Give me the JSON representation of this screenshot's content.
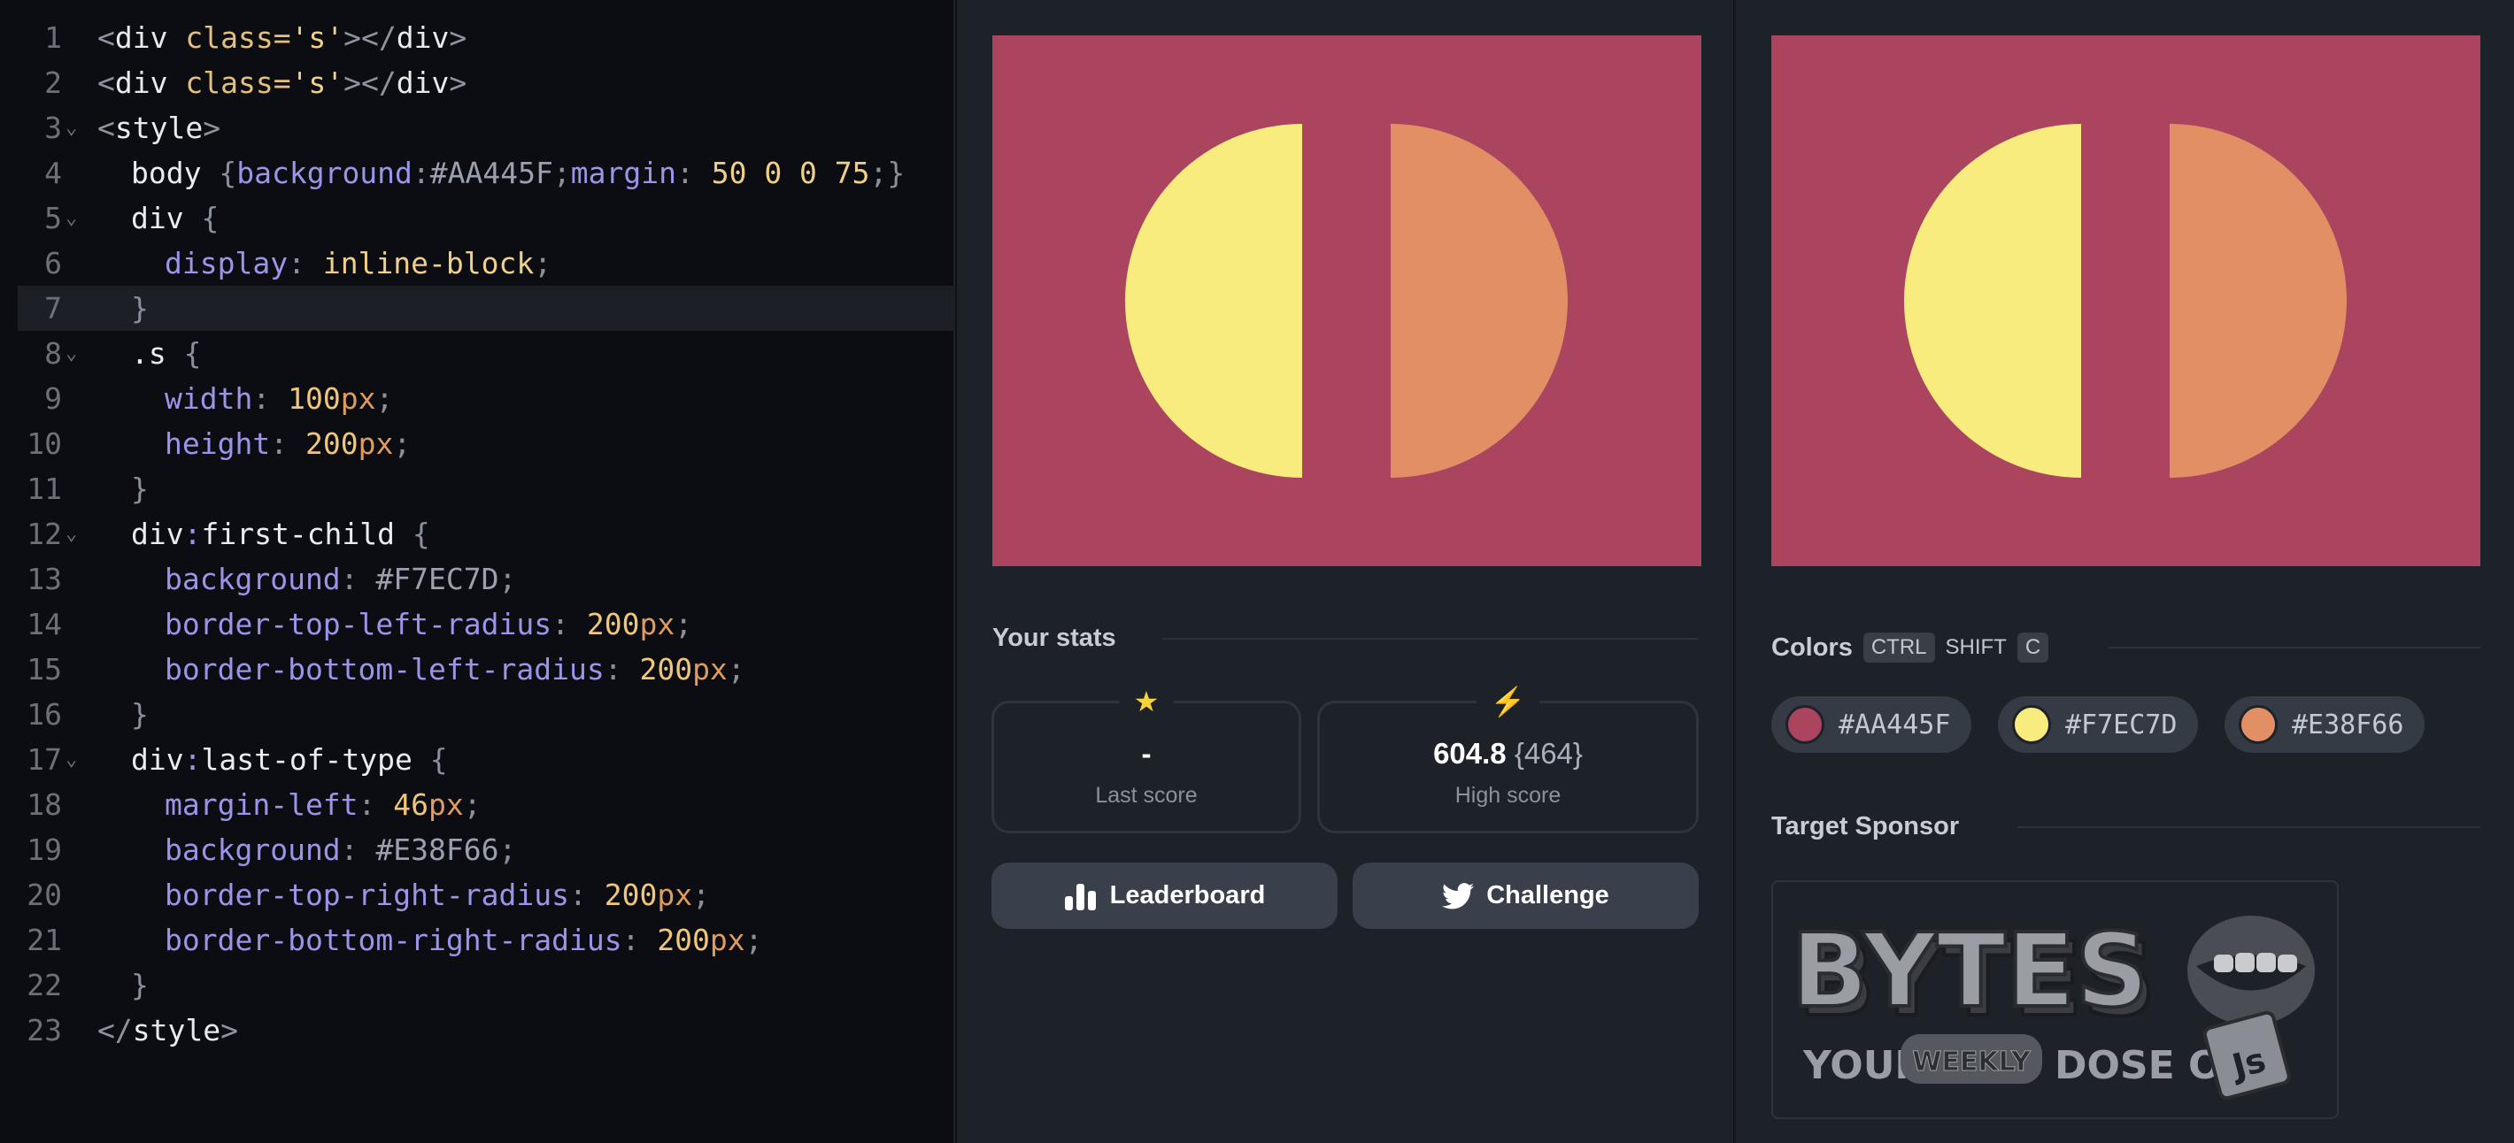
{
  "editor": {
    "lines": [
      {
        "n": "1"
      },
      {
        "n": "2"
      },
      {
        "n": "3"
      },
      {
        "n": "4"
      },
      {
        "n": "5"
      },
      {
        "n": "6"
      },
      {
        "n": "7"
      },
      {
        "n": "8"
      },
      {
        "n": "9"
      },
      {
        "n": "10"
      },
      {
        "n": "11"
      },
      {
        "n": "12"
      },
      {
        "n": "13"
      },
      {
        "n": "14"
      },
      {
        "n": "15"
      },
      {
        "n": "16"
      },
      {
        "n": "17"
      },
      {
        "n": "18"
      },
      {
        "n": "19"
      },
      {
        "n": "20"
      },
      {
        "n": "21"
      },
      {
        "n": "22"
      },
      {
        "n": "23"
      }
    ],
    "fold_glyph": "⌄",
    "tokens": {
      "l1_tag_open": "<",
      "l1_name": "div",
      "l1_attr": " class=",
      "l1_str": "'s'",
      "l1_close": "></",
      "l1_name2": "div",
      "l1_end": ">",
      "l3_open": "<",
      "l3_name": "style",
      "l3_end": ">",
      "l4_sel": "body",
      "l4_brace": " {",
      "l4_p1": "background",
      "l4_c1": ":",
      "l4_v1": "#AA445F",
      "l4_s1": ";",
      "l4_p2": "margin",
      "l4_c2": ": ",
      "l4_v2": "50 0 0 75",
      "l4_s2": ";",
      "l4_close": "}",
      "l5_sel": "div",
      "l5_brace": " {",
      "l6_p": "display",
      "l6_c": ": ",
      "l6_v": "inline-block",
      "l6_s": ";",
      "l7_close": "}",
      "l8_sel": ".s",
      "l8_brace": " {",
      "l9_p": "width",
      "l9_c": ": ",
      "l9_n": "100",
      "l9_u": "px",
      "l9_s": ";",
      "l10_p": "height",
      "l10_c": ": ",
      "l10_n": "200",
      "l10_u": "px",
      "l10_s": ";",
      "l11_close": "}",
      "l12_sel": "div",
      "l12_colon": ":",
      "l12_pseudo": "first-child",
      "l12_brace": " {",
      "l13_p": "background",
      "l13_c": ": ",
      "l13_v": "#F7EC7D",
      "l13_s": ";",
      "l14_p": "border-top-left-radius",
      "l14_c": ": ",
      "l14_n": "200",
      "l14_u": "px",
      "l14_s": ";",
      "l15_p": "border-bottom-left-radius",
      "l15_c": ": ",
      "l15_n": "200",
      "l15_u": "px",
      "l15_s": ";",
      "l16_close": "}",
      "l17_sel": "div",
      "l17_colon": ":",
      "l17_pseudo": "last-of-type",
      "l17_brace": " {",
      "l18_p": "margin-left",
      "l18_c": ": ",
      "l18_n": "46",
      "l18_u": "px",
      "l18_s": ";",
      "l19_p": "background",
      "l19_c": ": ",
      "l19_v": "#E38F66",
      "l19_s": ";",
      "l20_p": "border-top-right-radius",
      "l20_c": ": ",
      "l20_n": "200",
      "l20_u": "px",
      "l20_s": ";",
      "l21_p": "border-bottom-right-radius",
      "l21_c": ": ",
      "l21_n": "200",
      "l21_u": "px",
      "l21_s": ";",
      "l22_close": "}",
      "l23_open": "</",
      "l23_name": "style",
      "l23_end": ">"
    }
  },
  "stats": {
    "title": "Your stats",
    "last_score": {
      "icon": "★",
      "value": "-",
      "label": "Last score"
    },
    "high_score": {
      "icon": "⚡",
      "value": "604.8",
      "extra": "{464}",
      "label": "High score"
    },
    "leaderboard_label": "Leaderboard",
    "challenge_label": "Challenge"
  },
  "colors": {
    "title": "Colors",
    "key_ctrl": "CTRL",
    "key_shift": "SHIFT",
    "key_c": "C",
    "swatches": [
      {
        "hex": "#AA445F"
      },
      {
        "hex": "#F7EC7D"
      },
      {
        "hex": "#E38F66"
      }
    ]
  },
  "sponsor": {
    "title": "Target Sponsor",
    "logo_text": "BYTES",
    "tagline_1": "YOUR",
    "tagline_2": "WEEKLY",
    "tagline_3": "DOSE OF",
    "badge": "Js"
  }
}
